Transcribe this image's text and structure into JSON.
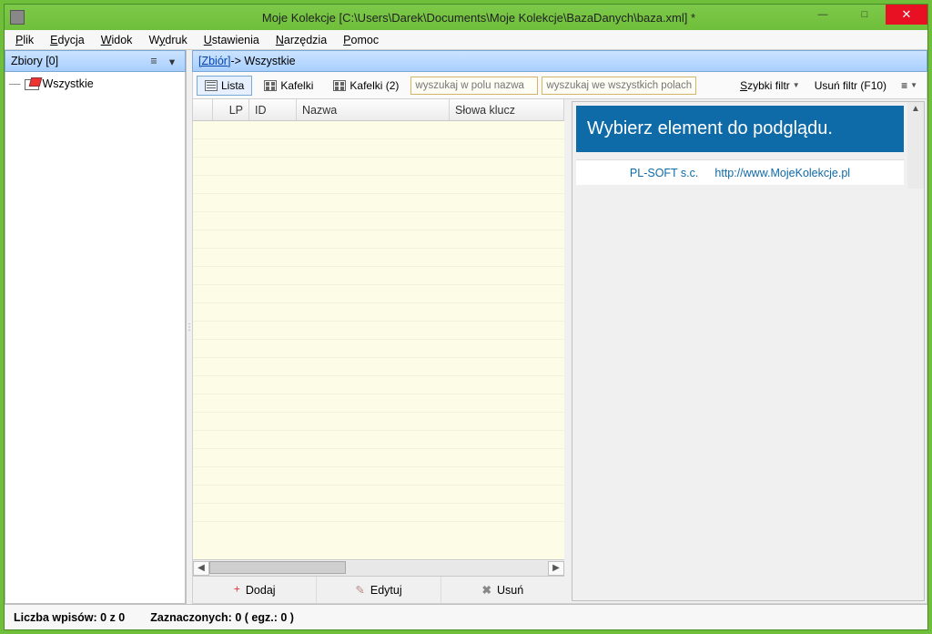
{
  "window": {
    "title": "Moje Kolekcje [C:\\Users\\Darek\\Documents\\Moje Kolekcje\\BazaDanych\\baza.xml] *"
  },
  "menu": {
    "file": "Plik",
    "edit": "Edycja",
    "view": "Widok",
    "print": "Wydruk",
    "settings": "Ustawienia",
    "tools": "Narzędzia",
    "help": "Pomoc"
  },
  "sidebar": {
    "header": "Zbiory [0]",
    "items": [
      {
        "label": "Wszystkie"
      }
    ]
  },
  "breadcrumb": {
    "link": "[Zbiór]",
    "rest": " -> Wszystkie"
  },
  "toolbar": {
    "lista": "Lista",
    "kafelki": "Kafelki",
    "kafelki2": "Kafelki (2)",
    "search_name_placeholder": "wyszukaj w polu nazwa",
    "search_all_placeholder": "wyszukaj we wszystkich polach",
    "quickfilter": "Szybki filtr",
    "clearfilter": "Usuń filtr (F10)"
  },
  "grid": {
    "cols": {
      "lp": "LP",
      "id": "ID",
      "name": "Nazwa",
      "keywords": "Słowa klucz"
    }
  },
  "actions": {
    "add": "Dodaj",
    "edit": "Edytuj",
    "del": "Usuń"
  },
  "preview": {
    "banner": "Wybierz element do podglądu.",
    "company": "PL-SOFT s.c.",
    "url": "http://www.MojeKolekcje.pl"
  },
  "status": {
    "count": "Liczba wpisów: 0 z 0",
    "selected": "Zaznaczonych: 0 (  egz.: 0 )"
  }
}
